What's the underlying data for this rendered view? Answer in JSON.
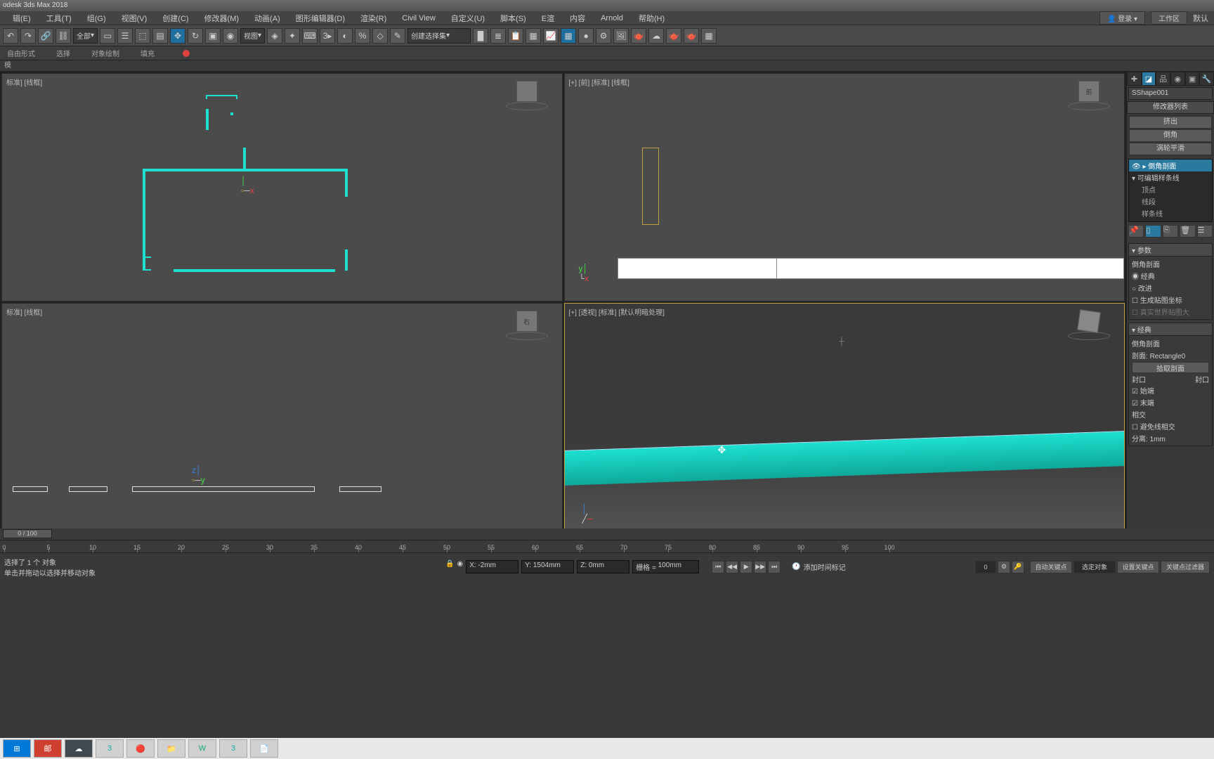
{
  "app": {
    "title": "odesk 3ds Max 2018"
  },
  "menu": {
    "items": [
      "辑(E)",
      "工具(T)",
      "组(G)",
      "视图(V)",
      "创建(C)",
      "修改器(M)",
      "动画(A)",
      "图形编辑器(D)",
      "渲染(R)",
      "Civil View",
      "自定义(U)",
      "脚本(S)",
      "E渲",
      "内容",
      "Arnold",
      "帮助(H)"
    ],
    "login": "登录",
    "workspace": "工作区",
    "default": "默认"
  },
  "toolbar": {
    "allLabel": "全部",
    "viewLabel": "视图",
    "selSetLabel": "创建选择集"
  },
  "ribbon": {
    "tabs": [
      "自由形式",
      "选择",
      "对象绘制",
      "填充"
    ],
    "header": "模"
  },
  "viewports": {
    "tl": "标准] [线框]",
    "tr": "[+] [前] [标准] [线框]",
    "bl": "标准] [线框]",
    "br": "[+] [透视] [标准] [默认明暗处理]",
    "cubeFront": "前",
    "cubeRight": "右"
  },
  "cmd": {
    "objName": "SShape001",
    "modListHeader": "修改器列表",
    "modButtons": [
      "挤出",
      "倒角",
      "涡轮平滑"
    ],
    "stack": {
      "top": "倒角剖面",
      "parent": "可编辑样条线",
      "subs": [
        "顶点",
        "线段",
        "样条线"
      ]
    },
    "params": {
      "header1": "参数",
      "bevelProfile": "倒角剖面",
      "classic": "经典",
      "improved": "改进",
      "genMapping": "生成贴图坐标",
      "realWorld": "真实世界贴图大",
      "header2": "经典",
      "bevelProfile2": "倒角剖面",
      "profileLabel": "剖面:",
      "profileVal": "Rectangle0",
      "pickProfile": "拾取剖面",
      "cap": "封口",
      "capEnd": "封口",
      "start": "始端",
      "end": "末端",
      "intersect": "相交",
      "avoidIntersect": "避免线相交",
      "separate": "分离:",
      "separateVal": "1mm"
    }
  },
  "timeslider": {
    "pos": "0 / 100"
  },
  "timeline": {
    "ticks": [
      0,
      5,
      10,
      15,
      20,
      25,
      30,
      35,
      40,
      45,
      50,
      55,
      60,
      65,
      70,
      75,
      80,
      85,
      90,
      95,
      100
    ]
  },
  "status": {
    "msg1": "选择了 1 个 对象",
    "msg2": "单击并拖动以选择并移动对象",
    "xLabel": "X:",
    "xVal": "-2mm",
    "yLabel": "Y:",
    "yVal": "1504mm",
    "zLabel": "Z:",
    "zVal": "0mm",
    "gridLabel": "栅格 =",
    "gridVal": "100mm",
    "addTimeTag": "添加时间标记",
    "autoKey": "自动关键点",
    "selObj": "选定对象",
    "setKey": "设置关键点",
    "keyFilters": "关键点过滤器"
  }
}
